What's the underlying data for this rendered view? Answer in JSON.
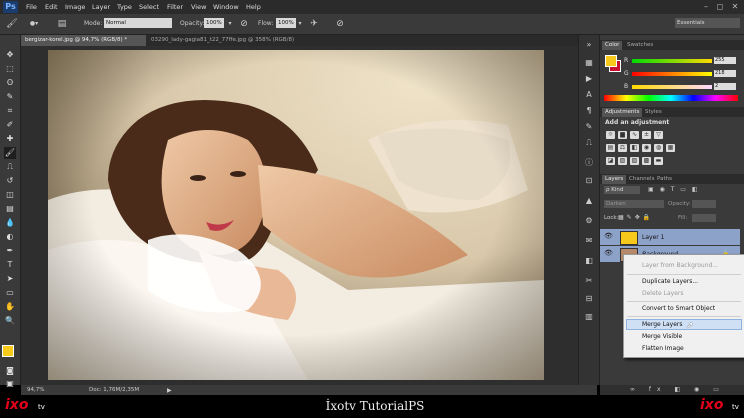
{
  "app": {
    "logo": "Ps"
  },
  "menu": [
    "File",
    "Edit",
    "Image",
    "Layer",
    "Type",
    "Select",
    "Filter",
    "View",
    "Window",
    "Help"
  ],
  "window_controls": [
    "–",
    "◻",
    "✕"
  ],
  "options": {
    "mode_label": "Mode:",
    "mode_value": "Normal",
    "opacity_label": "Opacity:",
    "opacity_value": "100%",
    "flow_label": "Flow:",
    "flow_value": "100%",
    "workspace": "Essentials"
  },
  "doc_tabs": [
    {
      "label": "bergizar-korel.jpg @ 94,7% (RGB/8) *",
      "active": true
    },
    {
      "label": "03290_lady-gagia81_t22_77ffe.jpg @ 358% (RGB/8)",
      "active": false
    }
  ],
  "status": {
    "zoom": "94,7%",
    "doc": "Doc: 1,76M/2,35M"
  },
  "color_panel": {
    "tabs": [
      "Color",
      "Swatches"
    ],
    "foreground": "#f6c91a",
    "background": "#c8102e",
    "channels": [
      {
        "name": "R",
        "value": "255"
      },
      {
        "name": "G",
        "value": "218"
      },
      {
        "name": "B",
        "value": "2"
      }
    ]
  },
  "adjustments_panel": {
    "tabs": [
      "Adjustments",
      "Styles"
    ],
    "heading": "Add an adjustment"
  },
  "layers_panel": {
    "tabs": [
      "Layers",
      "Channels",
      "Paths"
    ],
    "kind_label": "ρ Kind",
    "blend_mode": "Darken",
    "opacity_label": "Opacity:",
    "lock_label": "Lock:",
    "fill_label": "Fill:",
    "layers": [
      {
        "name": "Layer 1",
        "color": "#f6c91a"
      },
      {
        "name": "Background",
        "color": "#b58a6a"
      }
    ]
  },
  "context_menu": {
    "items": [
      {
        "label": "Layer from Background...",
        "enabled": false
      },
      {
        "label": "Duplicate Layers...",
        "enabled": true
      },
      {
        "label": "Delete Layers",
        "enabled": false
      },
      {
        "label": "Convert to Smart Object",
        "enabled": true
      },
      {
        "label": "Merge Layers",
        "enabled": true,
        "hover": true
      },
      {
        "label": "Merge Visible",
        "enabled": true
      },
      {
        "label": "Flatten Image",
        "enabled": true
      }
    ]
  },
  "watermark": {
    "brand": "ixo",
    "tv": "tv",
    "caption": "İxotv TutorialPS"
  }
}
